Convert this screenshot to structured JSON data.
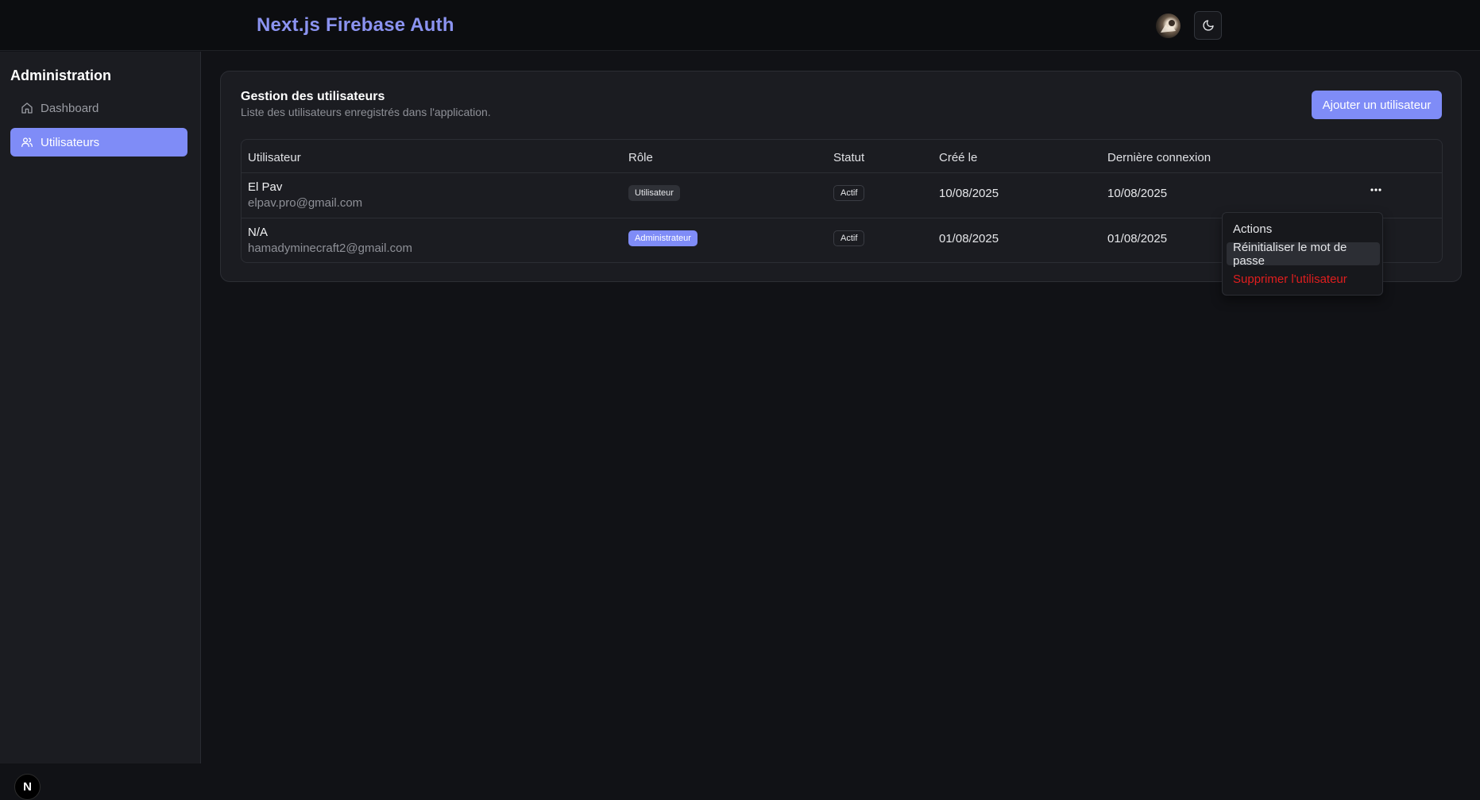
{
  "header": {
    "brand": "Next.js Firebase Auth",
    "avatar_alt": "user avatar",
    "theme_icon": "moon-icon"
  },
  "sidebar": {
    "title": "Administration",
    "items": [
      {
        "label": "Dashboard",
        "icon": "home-icon",
        "active": false
      },
      {
        "label": "Utilisateurs",
        "icon": "users-icon",
        "active": true
      }
    ],
    "footer_logo": "N"
  },
  "card": {
    "title": "Gestion des utilisateurs",
    "subtitle": "Liste des utilisateurs enregistrés dans l'application.",
    "add_button": "Ajouter un utilisateur"
  },
  "table": {
    "headers": [
      "Utilisateur",
      "Rôle",
      "Statut",
      "Créé le",
      "Dernière connexion"
    ],
    "rows": [
      {
        "name": "El Pav",
        "email": "elpav.pro@gmail.com",
        "role": "Utilisateur",
        "status": "Actif",
        "created": "10/08/2025",
        "last_login": "10/08/2025",
        "actions_icon": "more-horizontal-icon"
      },
      {
        "name": "N/A",
        "email": "hamadyminecraft2@gmail.com",
        "role": "Administrateur",
        "status": "Actif",
        "created": "01/08/2025",
        "last_login": "01/08/2025"
      }
    ]
  },
  "menu": {
    "label": "Actions",
    "items": [
      "Réinitialiser le mot de passe",
      "Supprimer l'utilisateur"
    ]
  },
  "colors": {
    "accent": "#7f8cf7",
    "brand_text": "#8b93f0",
    "danger": "#e01e1e",
    "background": "#111216"
  }
}
